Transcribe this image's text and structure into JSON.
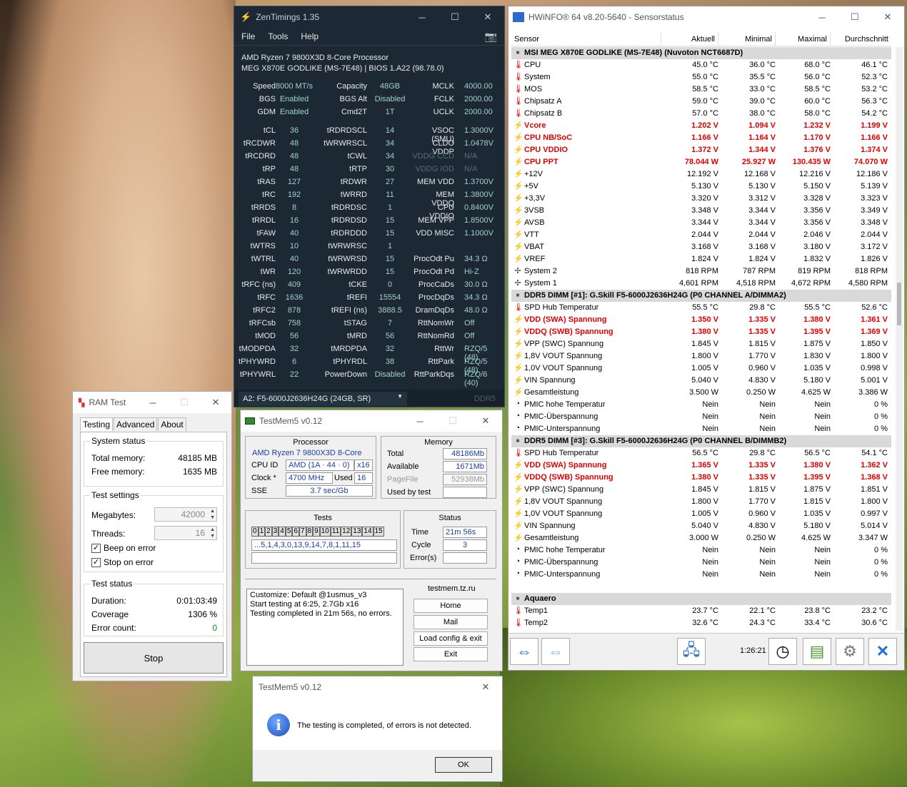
{
  "zen": {
    "title": "ZenTimings 1.35",
    "menu": [
      "File",
      "Tools",
      "Help"
    ],
    "cpu": "AMD Ryzen 7 9800X3D 8-Core Processor",
    "board": "MEG X870E GODLIKE (MS-7E48) | BIOS 1.A22 (98.78.0)",
    "top": [
      [
        "Speed",
        "8000 MT/s",
        "Capacity",
        "48GB",
        "MCLK",
        "4000.00"
      ],
      [
        "BGS",
        "Enabled",
        "BGS Alt",
        "Disabled",
        "FCLK",
        "2000.00"
      ],
      [
        "GDM",
        "Enabled",
        "Cmd2T",
        "1T",
        "UCLK",
        "2000.00"
      ]
    ],
    "rows": [
      [
        "tCL",
        "36",
        "tRDRDSCL",
        "14",
        "VSOC (SMU)",
        "1.3000V"
      ],
      [
        "tRCDWR",
        "48",
        "tWRWRSCL",
        "34",
        "CLDO VDDP",
        "1.0478V"
      ],
      [
        "tRCDRD",
        "48",
        "tCWL",
        "34",
        "VDDG CCD",
        "N/A"
      ],
      [
        "tRP",
        "48",
        "tRTP",
        "30",
        "VDDG IOD",
        "N/A"
      ],
      [
        "tRAS",
        "127",
        "tRDWR",
        "27",
        "MEM VDD",
        "1.3700V"
      ],
      [
        "tRC",
        "192",
        "tWRRD",
        "11",
        "MEM VDDQ",
        "1.3800V"
      ],
      [
        "tRRDS",
        "8",
        "tRDRDSC",
        "1",
        "CPU VDDIO",
        "0.8400V"
      ],
      [
        "tRRDL",
        "16",
        "tRDRDSD",
        "15",
        "MEM VPP",
        "1.8500V"
      ],
      [
        "tFAW",
        "40",
        "tRDRDDD",
        "15",
        "VDD MISC",
        "1.1000V"
      ],
      [
        "tWTRS",
        "10",
        "tWRWRSC",
        "1",
        "",
        ""
      ],
      [
        "tWTRL",
        "40",
        "tWRWRSD",
        "15",
        "ProcOdt Pu",
        "34.3 Ω"
      ],
      [
        "tWR",
        "120",
        "tWRWRDD",
        "15",
        "ProcOdt Pd",
        "Hi-Z"
      ],
      [
        "tRFC (ns)",
        "409",
        "tCKE",
        "0",
        "ProcCaDs",
        "30.0 Ω"
      ],
      [
        "tRFC",
        "1636",
        "tREFI",
        "15554",
        "ProcDqDs",
        "34.3 Ω"
      ],
      [
        "tRFC2",
        "878",
        "tREFI (ns)",
        "3888.5",
        "DramDqDs",
        "48.0 Ω"
      ],
      [
        "tRFCsb",
        "758",
        "tSTAG",
        "7",
        "RttNomWr",
        "Off"
      ],
      [
        "tMOD",
        "56",
        "tMRD",
        "56",
        "RttNomRd",
        "Off"
      ],
      [
        "tMODPDA",
        "32",
        "tMRDPDA",
        "32",
        "RttWr",
        "RZQ/5 (48)"
      ],
      [
        "tPHYWRD",
        "6",
        "tPHYRDL",
        "38",
        "RttPark",
        "RZQ/5 (48)"
      ],
      [
        "tPHYWRL",
        "22",
        "PowerDown",
        "Disabled",
        "RttParkDqs",
        "RZQ/6 (40)"
      ]
    ],
    "dimm": "A2: F5-6000J2636H24G (24GB, SR)",
    "ddr": "DDR5"
  },
  "hw": {
    "title": "HWiNFO® 64 v8.20-5640 - Sensorstatus",
    "cols": [
      "Sensor",
      "Aktuell",
      "Minimal",
      "Maximal",
      "Durchschnitt"
    ],
    "time": "1:26:21",
    "rows": [
      {
        "t": "g",
        "n": "MSI MEG X870E GODLIKE (MS-7E48) (Nuvoton NCT6687D)"
      },
      {
        "t": "temp",
        "n": "CPU",
        "v": [
          "45.0 °C",
          "36.0 °C",
          "68.0 °C",
          "46.1 °C"
        ]
      },
      {
        "t": "temp",
        "n": "System",
        "v": [
          "55.0 °C",
          "35.5 °C",
          "56.0 °C",
          "52.3 °C"
        ]
      },
      {
        "t": "temp",
        "n": "MOS",
        "v": [
          "58.5 °C",
          "33.0 °C",
          "58.5 °C",
          "53.2 °C"
        ]
      },
      {
        "t": "temp",
        "n": "Chipsatz A",
        "v": [
          "59.0 °C",
          "39.0 °C",
          "60.0 °C",
          "56.3 °C"
        ]
      },
      {
        "t": "temp",
        "n": "Chipsatz B",
        "v": [
          "57.0 °C",
          "38.0 °C",
          "58.0 °C",
          "54.2 °C"
        ]
      },
      {
        "t": "volt",
        "r": 1,
        "n": "Vcore",
        "v": [
          "1.202 V",
          "1.094 V",
          "1.232 V",
          "1.199 V"
        ]
      },
      {
        "t": "volt",
        "r": 1,
        "n": "CPU NB/SoC",
        "v": [
          "1.166 V",
          "1.164 V",
          "1.170 V",
          "1.166 V"
        ]
      },
      {
        "t": "volt",
        "r": 1,
        "n": "CPU VDDIO",
        "v": [
          "1.372 V",
          "1.344 V",
          "1.376 V",
          "1.374 V"
        ]
      },
      {
        "t": "volt",
        "r": 1,
        "n": "CPU PPT",
        "v": [
          "78.044 W",
          "25.927 W",
          "130.435 W",
          "74.070 W"
        ]
      },
      {
        "t": "volt",
        "n": "+12V",
        "v": [
          "12.192 V",
          "12.168 V",
          "12.216 V",
          "12.186 V"
        ]
      },
      {
        "t": "volt",
        "n": "+5V",
        "v": [
          "5.130 V",
          "5.130 V",
          "5.150 V",
          "5.139 V"
        ]
      },
      {
        "t": "volt",
        "n": "+3,3V",
        "v": [
          "3.320 V",
          "3.312 V",
          "3.328 V",
          "3.323 V"
        ]
      },
      {
        "t": "volt",
        "n": "3VSB",
        "v": [
          "3.348 V",
          "3.344 V",
          "3.356 V",
          "3.349 V"
        ]
      },
      {
        "t": "volt",
        "n": "AVSB",
        "v": [
          "3.344 V",
          "3.344 V",
          "3.356 V",
          "3.348 V"
        ]
      },
      {
        "t": "volt",
        "n": "VTT",
        "v": [
          "2.044 V",
          "2.044 V",
          "2.046 V",
          "2.044 V"
        ]
      },
      {
        "t": "volt",
        "n": "VBAT",
        "v": [
          "3.168 V",
          "3.168 V",
          "3.180 V",
          "3.172 V"
        ]
      },
      {
        "t": "volt",
        "n": "VREF",
        "v": [
          "1.824 V",
          "1.824 V",
          "1.832 V",
          "1.826 V"
        ]
      },
      {
        "t": "fan",
        "n": "System 2",
        "v": [
          "818 RPM",
          "787 RPM",
          "819 RPM",
          "818 RPM"
        ]
      },
      {
        "t": "fan",
        "n": "System 1",
        "v": [
          "4,601 RPM",
          "4,518 RPM",
          "4,672 RPM",
          "4,580 RPM"
        ]
      },
      {
        "t": "g",
        "n": "DDR5 DIMM [#1]: G.Skill F5-6000J2636H24G (P0 CHANNEL A/DIMMA2)"
      },
      {
        "t": "temp",
        "n": "SPD Hub Temperatur",
        "v": [
          "55.5 °C",
          "29.8 °C",
          "55.5 °C",
          "52.6 °C"
        ]
      },
      {
        "t": "volt",
        "r": 1,
        "n": "VDD (SWA) Spannung",
        "v": [
          "1.350 V",
          "1.335 V",
          "1.380 V",
          "1.361 V"
        ]
      },
      {
        "t": "volt",
        "r": 1,
        "n": "VDDQ (SWB) Spannung",
        "v": [
          "1.380 V",
          "1.335 V",
          "1.395 V",
          "1.369 V"
        ]
      },
      {
        "t": "volt",
        "n": "VPP (SWC) Spannung",
        "v": [
          "1.845 V",
          "1.815 V",
          "1.875 V",
          "1.850 V"
        ]
      },
      {
        "t": "volt",
        "n": "1,8V VOUT Spannung",
        "v": [
          "1.800 V",
          "1.770 V",
          "1.830 V",
          "1.800 V"
        ]
      },
      {
        "t": "volt",
        "n": "1,0V VOUT Spannung",
        "v": [
          "1.005 V",
          "0.960 V",
          "1.035 V",
          "0.998 V"
        ]
      },
      {
        "t": "volt",
        "n": "VIN Spannung",
        "v": [
          "5.040 V",
          "4.830 V",
          "5.180 V",
          "5.001 V"
        ]
      },
      {
        "t": "volt",
        "n": "Gesamtleistung",
        "v": [
          "3.500 W",
          "0.250 W",
          "4.625 W",
          "3.386 W"
        ]
      },
      {
        "t": "clock",
        "n": "PMIC hohe Temperatur",
        "v": [
          "Nein",
          "Nein",
          "Nein",
          "0 %"
        ]
      },
      {
        "t": "clock",
        "n": "PMIC-Überspannung",
        "v": [
          "Nein",
          "Nein",
          "Nein",
          "0 %"
        ]
      },
      {
        "t": "clock",
        "n": "PMIC-Unterspannung",
        "v": [
          "Nein",
          "Nein",
          "Nein",
          "0 %"
        ]
      },
      {
        "t": "g",
        "n": "DDR5 DIMM [#3]: G.Skill F5-6000J2636H24G (P0 CHANNEL B/DIMMB2)"
      },
      {
        "t": "temp",
        "n": "SPD Hub Temperatur",
        "v": [
          "56.5 °C",
          "29.8 °C",
          "56.5 °C",
          "54.1 °C"
        ]
      },
      {
        "t": "volt",
        "r": 1,
        "n": "VDD (SWA) Spannung",
        "v": [
          "1.365 V",
          "1.335 V",
          "1.380 V",
          "1.362 V"
        ]
      },
      {
        "t": "volt",
        "r": 1,
        "n": "VDDQ (SWB) Spannung",
        "v": [
          "1.380 V",
          "1.335 V",
          "1.395 V",
          "1.368 V"
        ]
      },
      {
        "t": "volt",
        "n": "VPP (SWC) Spannung",
        "v": [
          "1.845 V",
          "1.815 V",
          "1.875 V",
          "1.851 V"
        ]
      },
      {
        "t": "volt",
        "n": "1,8V VOUT Spannung",
        "v": [
          "1.800 V",
          "1.770 V",
          "1.815 V",
          "1.800 V"
        ]
      },
      {
        "t": "volt",
        "n": "1,0V VOUT Spannung",
        "v": [
          "1.005 V",
          "0.960 V",
          "1.035 V",
          "0.997 V"
        ]
      },
      {
        "t": "volt",
        "n": "VIN Spannung",
        "v": [
          "5.040 V",
          "4.830 V",
          "5.180 V",
          "5.014 V"
        ]
      },
      {
        "t": "volt",
        "n": "Gesamtleistung",
        "v": [
          "3.000 W",
          "0.250 W",
          "4.625 W",
          "3.347 W"
        ]
      },
      {
        "t": "clock",
        "n": "PMIC hohe Temperatur",
        "v": [
          "Nein",
          "Nein",
          "Nein",
          "0 %"
        ]
      },
      {
        "t": "clock",
        "n": "PMIC-Überspannung",
        "v": [
          "Nein",
          "Nein",
          "Nein",
          "0 %"
        ]
      },
      {
        "t": "clock",
        "n": "PMIC-Unterspannung",
        "v": [
          "Nein",
          "Nein",
          "Nein",
          "0 %"
        ]
      },
      {
        "t": "blank",
        "n": ""
      },
      {
        "t": "g",
        "n": "Aquaero"
      },
      {
        "t": "temp",
        "n": "Temp1",
        "v": [
          "23.7 °C",
          "22.1 °C",
          "23.8 °C",
          "23.2 °C"
        ]
      },
      {
        "t": "temp",
        "n": "Temp2",
        "v": [
          "32.6 °C",
          "24.3 °C",
          "33.4 °C",
          "30.6 °C"
        ]
      }
    ]
  },
  "ram": {
    "title": "RAM Test",
    "tabs": [
      "Testing",
      "Advanced",
      "About"
    ],
    "sys_status": "System status",
    "total_label": "Total memory:",
    "total": "48185 MB",
    "free_label": "Free memory:",
    "free": "1635 MB",
    "settings": "Test settings",
    "mb_label": "Megabytes:",
    "mb": "42000",
    "thr_label": "Threads:",
    "thr": "16",
    "beep": "Beep on error",
    "stop_on": "Stop on error",
    "test_status": "Test status",
    "dur_label": "Duration:",
    "dur": "0:01:03:49",
    "cov_label": "Coverage",
    "cov": "1306 %",
    "err_label": "Error count:",
    "err": "0",
    "stop": "Stop"
  },
  "tm": {
    "title": "TestMem5 v0.12",
    "proc": "Processor",
    "cpu": "AMD Ryzen 7 9800X3D 8-Core",
    "cpuid_l": "CPU ID",
    "cpuid": "AMD  (1A · 44 · 0)",
    "x": "x16",
    "clock_l": "Clock *",
    "clock": "4700 MHz",
    "used_l": "Used",
    "used": "16",
    "sse_l": "SSE",
    "sse": "3.7 sec/Gb",
    "mem": "Memory",
    "total_l": "Total",
    "total": "48186Mb",
    "avail_l": "Available",
    "avail": "1671Mb",
    "page_l": "PageFile",
    "page": "52938Mb",
    "ubt_l": "Used by test",
    "ubt": "",
    "tests": "Tests",
    "digits": [
      "0",
      "1",
      "2",
      "3",
      "4",
      "5",
      "6",
      "7",
      "8",
      "9",
      "10",
      "11",
      "12",
      "13",
      "14",
      "15"
    ],
    "seq": "...5,1,4,3,0,13,9,14,7,8,1,11,15",
    "status": "Status",
    "time_l": "Time",
    "time": "21m 56s",
    "cycle_l": "Cycle",
    "cycle": "3",
    "err_l": "Error(s)",
    "err": "",
    "log": [
      "Customize: Default @1usmus_v3",
      "Start testing at 6:25, 2.7Gb x16",
      "Testing completed in 21m 56s, no errors."
    ],
    "site": "testmem.tz.ru",
    "btns": [
      "Home",
      "Mail",
      "Load config & exit",
      "Exit"
    ]
  },
  "dlg": {
    "title": "TestMem5 v0.12",
    "msg": "The testing is completed, of errors is not detected.",
    "ok": "OK"
  }
}
